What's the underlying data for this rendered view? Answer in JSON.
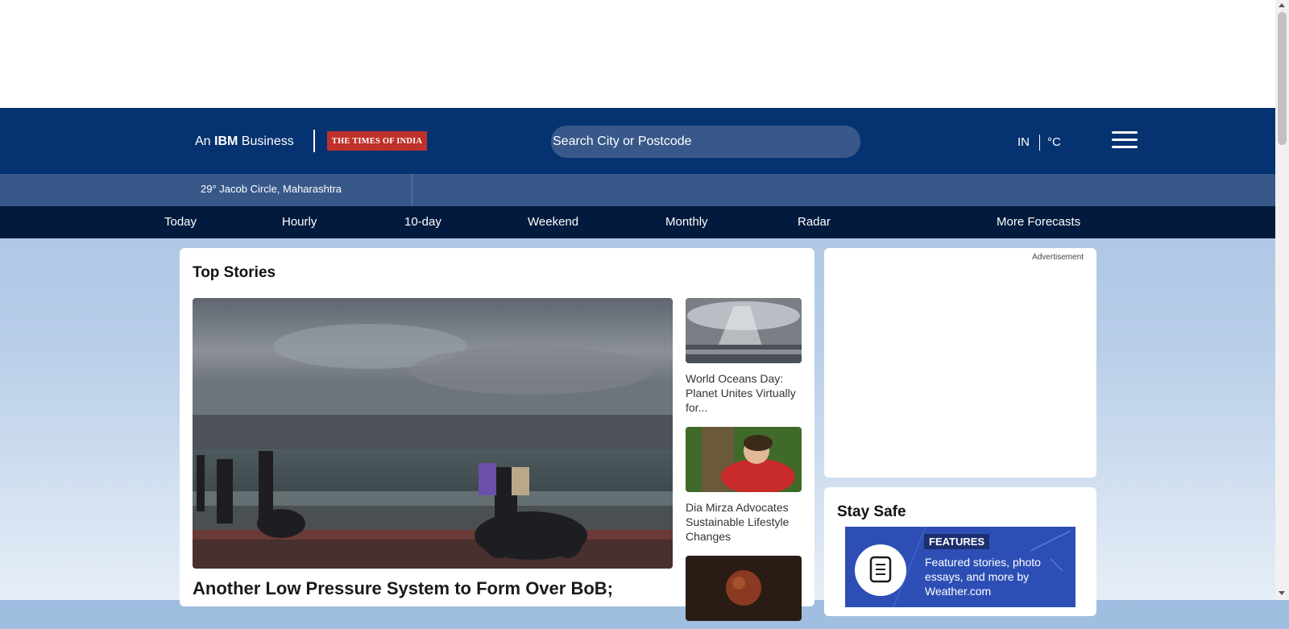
{
  "header": {
    "brand_prefix": "An ",
    "brand_bold": "IBM",
    "brand_suffix": " Business",
    "partner_logo": "THE TIMES OF INDIA",
    "search_placeholder": "Search City or Postcode",
    "region": "IN",
    "units": "°C",
    "menu_icon": "hamburger-icon"
  },
  "location": {
    "text": "29° Jacob Circle, Maharashtra"
  },
  "nav": {
    "items": [
      {
        "label": "Today"
      },
      {
        "label": "Hourly"
      },
      {
        "label": "10-day"
      },
      {
        "label": "Weekend"
      },
      {
        "label": "Monthly"
      },
      {
        "label": "Radar"
      },
      {
        "label": "More Forecasts"
      }
    ]
  },
  "top_stories": {
    "title": "Top Stories",
    "hero_title": "Another Low Pressure System to Form Over BoB;",
    "side": [
      {
        "title": "World Oceans Day: Planet Unites Virtually for..."
      },
      {
        "title": "Dia Mirza Advocates Sustainable Lifestyle Changes"
      },
      {
        "title": ""
      }
    ]
  },
  "ad": {
    "label": "Advertisement"
  },
  "stay_safe": {
    "title": "Stay Safe",
    "badge": "FEATURES",
    "text": "Featured stories, photo essays, and more by Weather.com",
    "icon": "document-icon"
  },
  "colors": {
    "header_bg": "#053270",
    "location_bg": "#38588a",
    "nav_bg": "#021a3d",
    "toi_red": "#c0302a",
    "feature_blue": "#2d4fb5"
  }
}
